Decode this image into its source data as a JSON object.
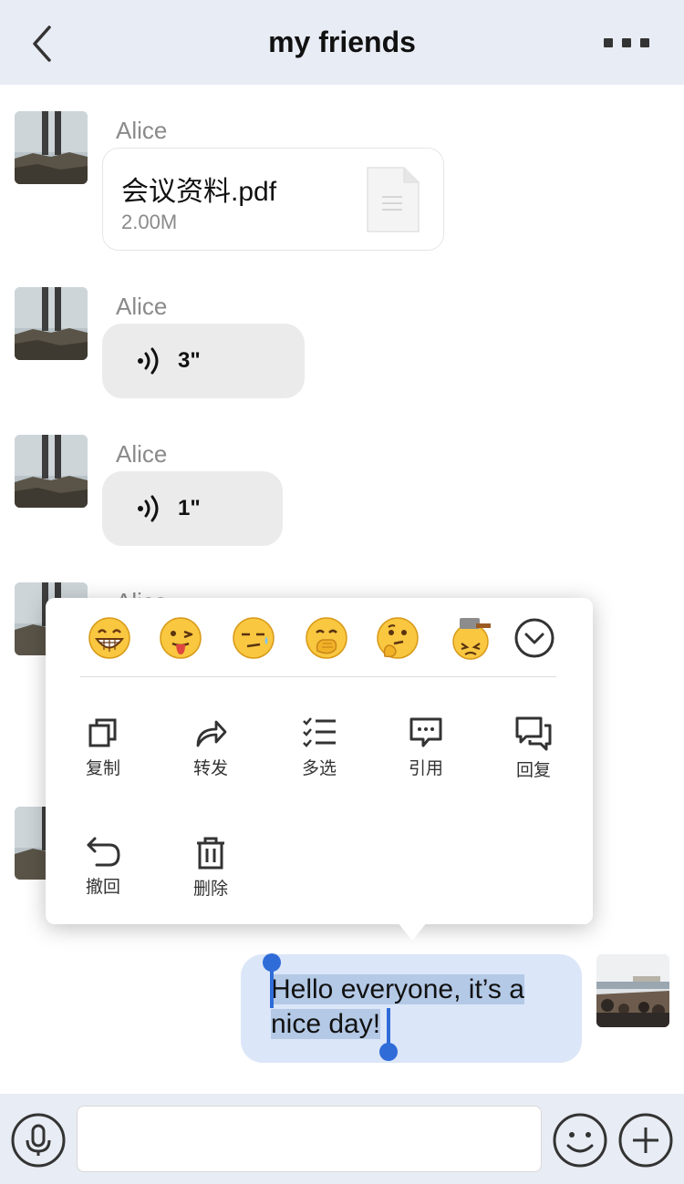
{
  "header": {
    "title": "my friends",
    "back_icon": "chevron-left-icon",
    "more_icon": "more-dots-icon"
  },
  "messages": [
    {
      "sender": "Alice",
      "type": "file",
      "file_name": "会议资料.pdf",
      "file_size": "2.00M"
    },
    {
      "sender": "Alice",
      "type": "voice",
      "duration": "3\""
    },
    {
      "sender": "Alice",
      "type": "voice",
      "duration": "1\""
    },
    {
      "sender": "Alice",
      "type": "hidden"
    },
    {
      "sender": "",
      "type": "hidden"
    }
  ],
  "popup": {
    "emojis": [
      "grin-emoji",
      "tongue-wink-emoji",
      "sweat-emoji",
      "hand-over-mouth-emoji",
      "thinking-emoji",
      "hammer-emoji"
    ],
    "expand_icon": "chevron-down-circle-icon",
    "actions": [
      {
        "label": "复制",
        "icon": "copy-icon"
      },
      {
        "label": "转发",
        "icon": "forward-icon"
      },
      {
        "label": "多选",
        "icon": "multi-select-icon"
      },
      {
        "label": "引用",
        "icon": "quote-icon"
      },
      {
        "label": "回复",
        "icon": "reply-icon"
      },
      {
        "label": "撤回",
        "icon": "recall-icon"
      },
      {
        "label": "删除",
        "icon": "trash-icon"
      }
    ]
  },
  "outgoing": {
    "line1": "Hello everyone, it’s a",
    "line2": "nice day!"
  },
  "input_bar": {
    "value": "",
    "mic_icon": "mic-icon",
    "emoji_icon": "smiley-icon",
    "plus_icon": "plus-circle-icon"
  },
  "colors": {
    "header_bg": "#e8ecf4",
    "outgoing_bubble": "#dbe6f8",
    "selection": "#b4c9e6",
    "cursor": "#2f6cd8",
    "voice_bubble": "#ebebeb"
  }
}
